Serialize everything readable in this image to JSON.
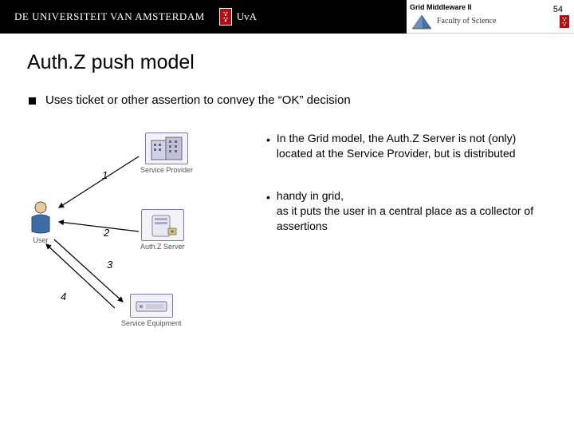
{
  "header": {
    "university": "DE UNIVERSITEIT VAN AMSTERDAM",
    "uva": "UvA",
    "course": "Grid Middleware II",
    "faculty": "Faculty of Science",
    "page": "54"
  },
  "slide": {
    "title": "Auth.Z push model",
    "main_bullet": "Uses ticket or other assertion to convey the “OK” decision",
    "sub1": "In the Grid model, the Auth.Z Server is not (only) located at the Service Provider, but is distributed",
    "sub2": "handy in grid,\nas it puts the user in a central place as a collector of assertions"
  },
  "diagram": {
    "user": "User",
    "service_provider": "Service Provider",
    "authz_server": "Auth.Z Server",
    "service_equipment": "Service Equipment",
    "n1": "1",
    "n2": "2",
    "n3": "3",
    "n4": "4"
  }
}
